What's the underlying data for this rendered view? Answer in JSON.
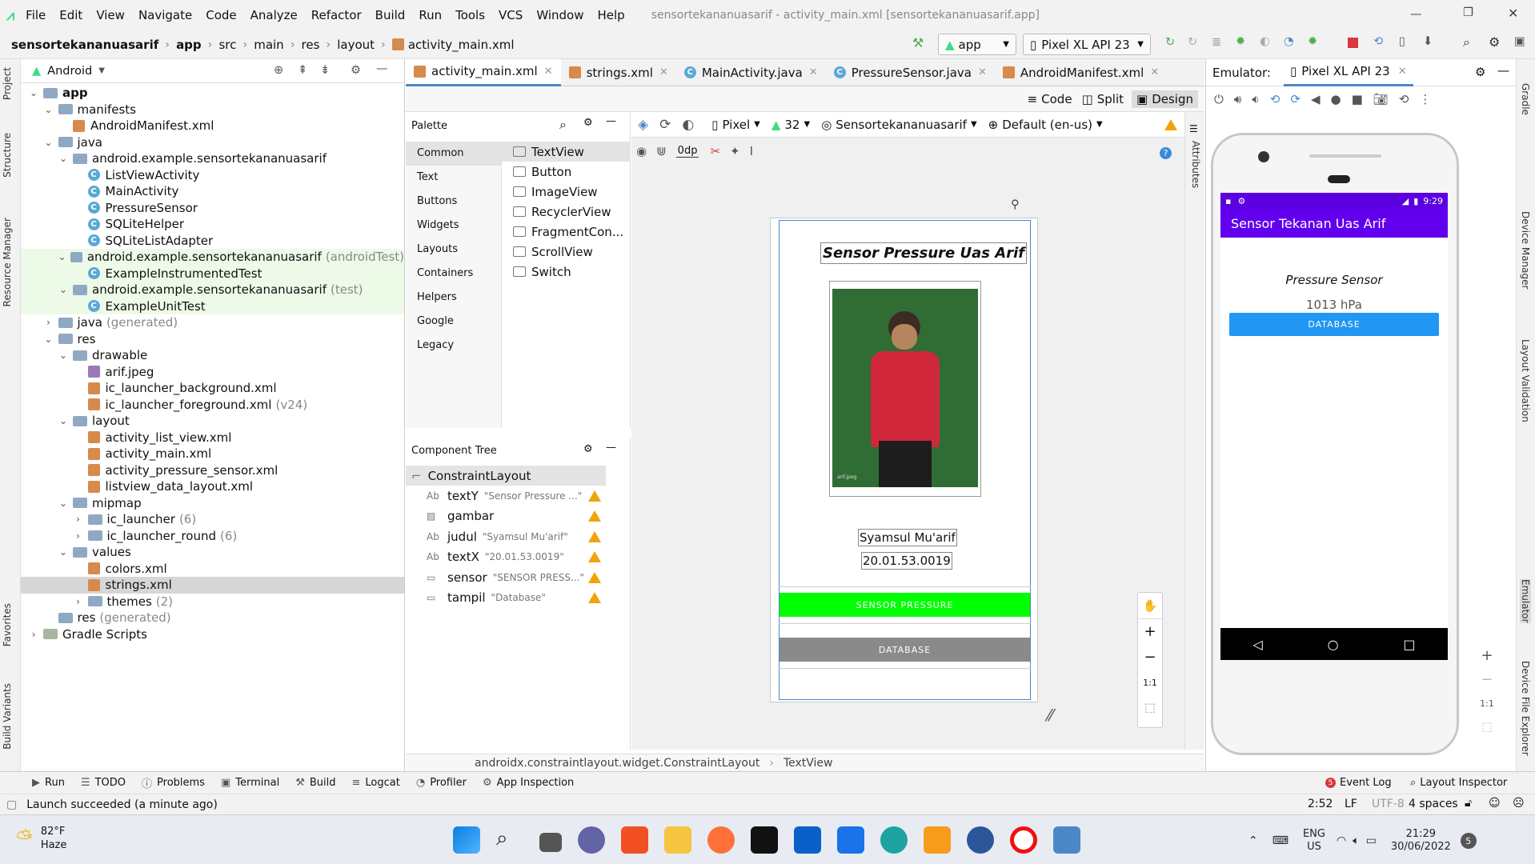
{
  "menu": [
    "File",
    "Edit",
    "View",
    "Navigate",
    "Code",
    "Analyze",
    "Refactor",
    "Build",
    "Run",
    "Tools",
    "VCS",
    "Window",
    "Help"
  ],
  "window_title": "sensortekananuasarif - activity_main.xml [sensortekananuasarif.app]",
  "breadcrumb": [
    "sensortekananuasarif",
    "app",
    "src",
    "main",
    "res",
    "layout",
    "activity_main.xml"
  ],
  "run_config": "app",
  "device": "Pixel XL API 23",
  "project_view": "Android",
  "tree": [
    {
      "label": "app",
      "level": 0,
      "kind": "module",
      "bold": true,
      "open": true
    },
    {
      "label": "manifests",
      "level": 1,
      "kind": "folder",
      "open": true
    },
    {
      "label": "AndroidManifest.xml",
      "level": 2,
      "kind": "xml"
    },
    {
      "label": "java",
      "level": 1,
      "kind": "folder",
      "open": true
    },
    {
      "label": "android.example.sensortekananuasarif",
      "level": 2,
      "kind": "pkg",
      "open": true
    },
    {
      "label": "ListViewActivity",
      "level": 3,
      "kind": "class"
    },
    {
      "label": "MainActivity",
      "level": 3,
      "kind": "class"
    },
    {
      "label": "PressureSensor",
      "level": 3,
      "kind": "class"
    },
    {
      "label": "SQLiteHelper",
      "level": 3,
      "kind": "class"
    },
    {
      "label": "SQLiteListAdapter",
      "level": 3,
      "kind": "class"
    },
    {
      "label": "android.example.sensortekananuasarif",
      "suffix": "(androidTest)",
      "level": 2,
      "kind": "pkg",
      "open": true,
      "green": true
    },
    {
      "label": "ExampleInstrumentedTest",
      "level": 3,
      "kind": "class",
      "green": true
    },
    {
      "label": "android.example.sensortekananuasarif",
      "suffix": "(test)",
      "level": 2,
      "kind": "pkg",
      "open": true,
      "green": true
    },
    {
      "label": "ExampleUnitTest",
      "level": 3,
      "kind": "class",
      "green": true
    },
    {
      "label": "java",
      "suffix": "(generated)",
      "level": 1,
      "kind": "folder",
      "open": false
    },
    {
      "label": "res",
      "level": 1,
      "kind": "folder",
      "open": true
    },
    {
      "label": "drawable",
      "level": 2,
      "kind": "folder",
      "open": true
    },
    {
      "label": "arif.jpeg",
      "level": 3,
      "kind": "img"
    },
    {
      "label": "ic_launcher_background.xml",
      "level": 3,
      "kind": "xml"
    },
    {
      "label": "ic_launcher_foreground.xml",
      "suffix": "(v24)",
      "level": 3,
      "kind": "xml"
    },
    {
      "label": "layout",
      "level": 2,
      "kind": "folder",
      "open": true
    },
    {
      "label": "activity_list_view.xml",
      "level": 3,
      "kind": "xml"
    },
    {
      "label": "activity_main.xml",
      "level": 3,
      "kind": "xml"
    },
    {
      "label": "activity_pressure_sensor.xml",
      "level": 3,
      "kind": "xml"
    },
    {
      "label": "listview_data_layout.xml",
      "level": 3,
      "kind": "xml"
    },
    {
      "label": "mipmap",
      "level": 2,
      "kind": "folder",
      "open": true
    },
    {
      "label": "ic_launcher",
      "suffix": "(6)",
      "level": 3,
      "kind": "folder",
      "open": false
    },
    {
      "label": "ic_launcher_round",
      "suffix": "(6)",
      "level": 3,
      "kind": "folder",
      "open": false
    },
    {
      "label": "values",
      "level": 2,
      "kind": "folder",
      "open": true
    },
    {
      "label": "colors.xml",
      "level": 3,
      "kind": "xml"
    },
    {
      "label": "strings.xml",
      "level": 3,
      "kind": "xml",
      "selected": true
    },
    {
      "label": "themes",
      "suffix": "(2)",
      "level": 3,
      "kind": "folder",
      "open": false
    },
    {
      "label": "res",
      "suffix": "(generated)",
      "level": 1,
      "kind": "folder"
    },
    {
      "label": "Gradle Scripts",
      "level": 0,
      "kind": "gradle",
      "open": false
    }
  ],
  "tabs": [
    "activity_main.xml",
    "strings.xml",
    "MainActivity.java",
    "PressureSensor.java",
    "AndroidManifest.xml"
  ],
  "view_modes": [
    "Code",
    "Split",
    "Design"
  ],
  "palette": {
    "title": "Palette",
    "categories": [
      "Common",
      "Text",
      "Buttons",
      "Widgets",
      "Layouts",
      "Containers",
      "Helpers",
      "Google",
      "Legacy"
    ],
    "items": [
      "TextView",
      "Button",
      "ImageView",
      "RecyclerView",
      "FragmentCon...",
      "ScrollView",
      "Switch"
    ]
  },
  "design_toolbar": {
    "device": "Pixel",
    "api": "32",
    "theme": "Sensortekananuasarif",
    "locale": "Default (en-us)",
    "margin": "0dp"
  },
  "component_tree": {
    "title": "Component Tree",
    "root": "ConstraintLayout",
    "items": [
      {
        "type": "Ab",
        "id": "textY",
        "hint": "\"Sensor Pressure ...\""
      },
      {
        "type": "img",
        "id": "gambar",
        "hint": ""
      },
      {
        "type": "Ab",
        "id": "judul",
        "hint": "\"Syamsul Mu'arif\""
      },
      {
        "type": "Ab",
        "id": "textX",
        "hint": "\"20.01.53.0019\""
      },
      {
        "type": "btn",
        "id": "sensor",
        "hint": "\"SENSOR PRESS...\""
      },
      {
        "type": "btn",
        "id": "tampil",
        "hint": "\"Database\""
      }
    ]
  },
  "preview": {
    "title": "Sensor Pressure Uas Arif",
    "name": "Syamsul Mu'arif",
    "nim": "20.01.53.0019",
    "button1": "SENSOR PRESSURE",
    "button2": "DATABASE",
    "photo_caption": "arif.jpeg"
  },
  "zoom_fit": "1:1",
  "design_breadcrumb": [
    "androidx.constraintlayout.widget.ConstraintLayout",
    "TextView"
  ],
  "emulator": {
    "label": "Emulator:",
    "device": "Pixel XL API 23",
    "time": "9:29",
    "app_title": "Sensor Tekanan Uas Arif",
    "sensor_label": "Pressure Sensor",
    "reading": "1013 hPa",
    "button": "DATABASE"
  },
  "tool_windows": [
    "Run",
    "TODO",
    "Problems",
    "Terminal",
    "Build",
    "Logcat",
    "Profiler",
    "App Inspection"
  ],
  "tool_windows_right": [
    "Event Log",
    "Layout Inspector"
  ],
  "left_stripe": [
    "Project",
    "Structure",
    "Resource Manager",
    "Favorites",
    "Build Variants"
  ],
  "right_stripe": [
    "Gradle",
    "Device Manager",
    "Layout Validation",
    "Emulator",
    "Device File Explorer"
  ],
  "attributes_label": "Attributes",
  "status": {
    "message": "Launch succeeded (a minute ago)",
    "pos": "2:52",
    "eol": "LF",
    "enc": "UTF-8",
    "indent": "4 spaces"
  },
  "weather": {
    "temp": "82°F",
    "cond": "Haze"
  },
  "tray": {
    "lang1": "ENG",
    "lang2": "US",
    "time": "21:29",
    "date": "30/06/2022",
    "badge": "5"
  },
  "colors": {
    "accent": "#6200ee",
    "status_bar": "#5b00e0",
    "green_btn": "#00ff00",
    "db_btn": "#8a8a8a",
    "emu_btn": "#2196f3"
  }
}
